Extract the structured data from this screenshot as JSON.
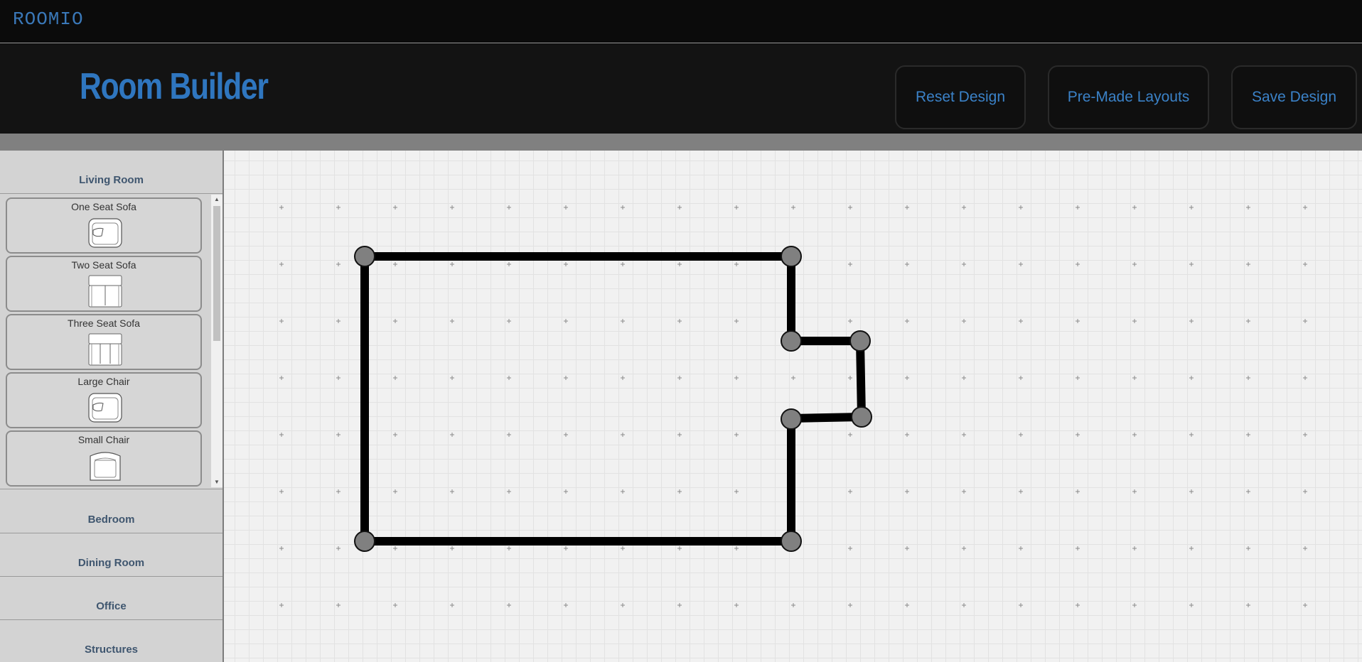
{
  "app": {
    "brand": "ROOMIO"
  },
  "header": {
    "title": "Room Builder",
    "buttons": {
      "reset": "Reset Design",
      "premade": "Pre-Made Layouts",
      "save": "Save Design"
    }
  },
  "sidebar": {
    "categories": {
      "living_room": "Living Room",
      "bedroom": "Bedroom",
      "dining_room": "Dining Room",
      "office": "Office",
      "structures": "Structures"
    },
    "living_room_items": [
      {
        "label": "One Seat Sofa",
        "icon": "one-seat-sofa-icon"
      },
      {
        "label": "Two Seat Sofa",
        "icon": "two-seat-sofa-icon"
      },
      {
        "label": "Three Seat Sofa",
        "icon": "three-seat-sofa-icon"
      },
      {
        "label": "Large Chair",
        "icon": "large-chair-icon"
      },
      {
        "label": "Small Chair",
        "icon": "small-chair-icon"
      }
    ]
  },
  "colors": {
    "accent": "#2f76bf",
    "wall": "#000000",
    "vertex_fill": "#808080",
    "canvas_bg": "#f1f1f1",
    "sidebar_bg": "#d3d3d3"
  }
}
